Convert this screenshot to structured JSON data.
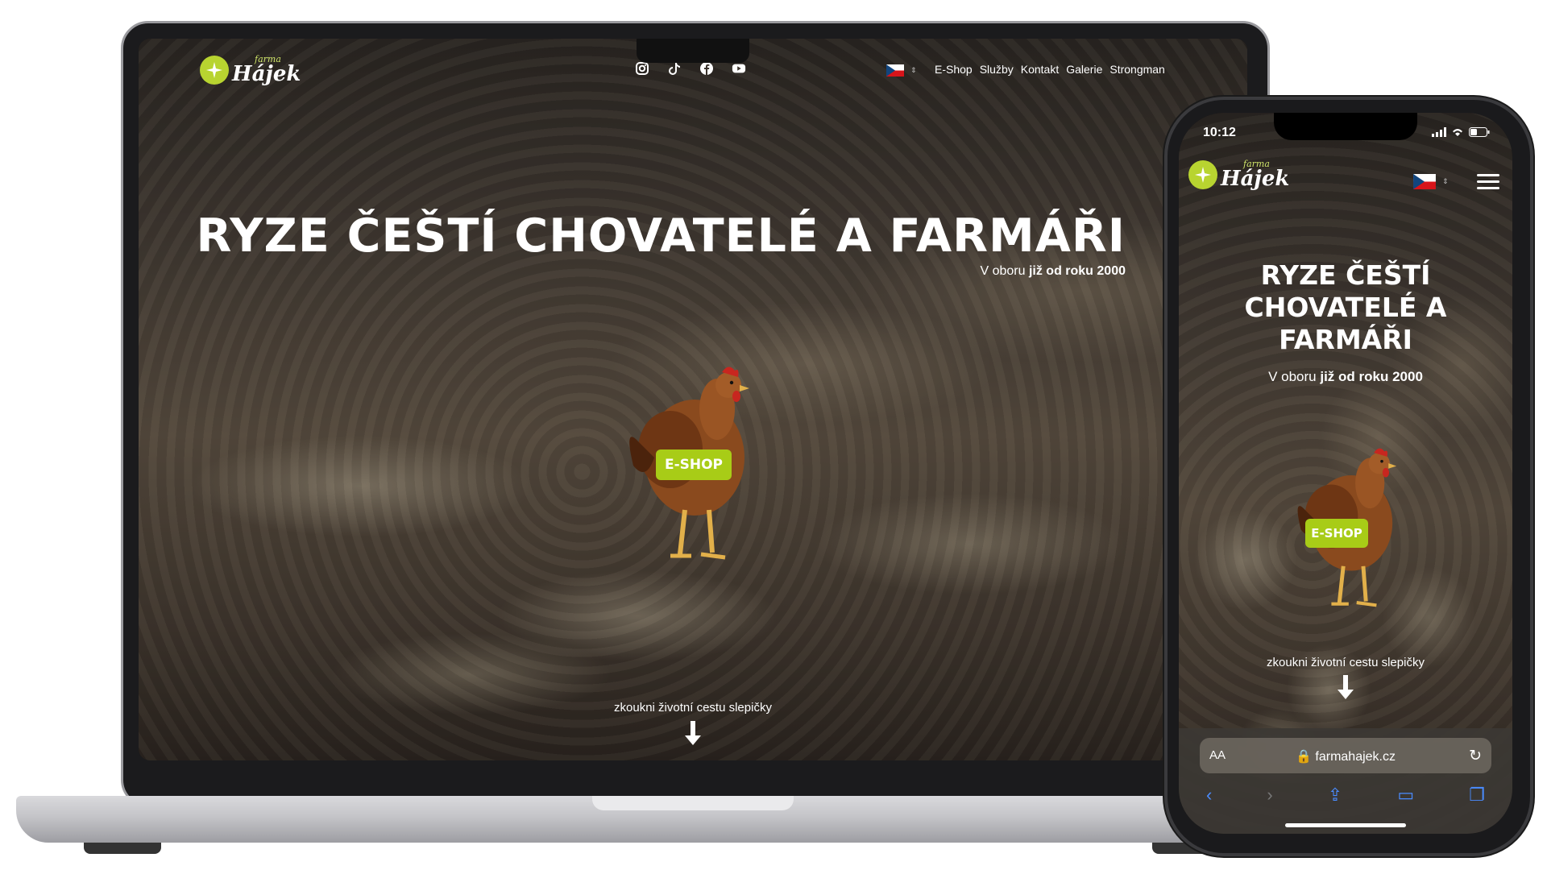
{
  "brand": {
    "small": "farma",
    "big": "Hájek"
  },
  "nav": {
    "items": [
      "E-Shop",
      "Služby",
      "Kontakt",
      "Galerie",
      "Strongman"
    ]
  },
  "social": [
    "instagram-icon",
    "tiktok-icon",
    "facebook-icon",
    "youtube-icon"
  ],
  "language": {
    "flag": "czech-flag"
  },
  "hero": {
    "title": "RYZE ČEŠTÍ CHOVATELÉ A FARMÁŘI",
    "subtitle_prefix": "V oboru",
    "subtitle_bold": "již od roku 2000",
    "eshop_label": "E-SHOP",
    "tagline": "zkoukni životní cestu slepičky"
  },
  "phone": {
    "time": "10:12",
    "title_lines": [
      "RYZE ČEŠTÍ",
      "CHOVATELÉ A",
      "FARMÁŘI"
    ],
    "url_text": "farmahajek.cz",
    "aa_label": "AA"
  },
  "colors": {
    "accent": "#a8cc17",
    "logo": "#b8d430",
    "text": "#ffffff"
  }
}
